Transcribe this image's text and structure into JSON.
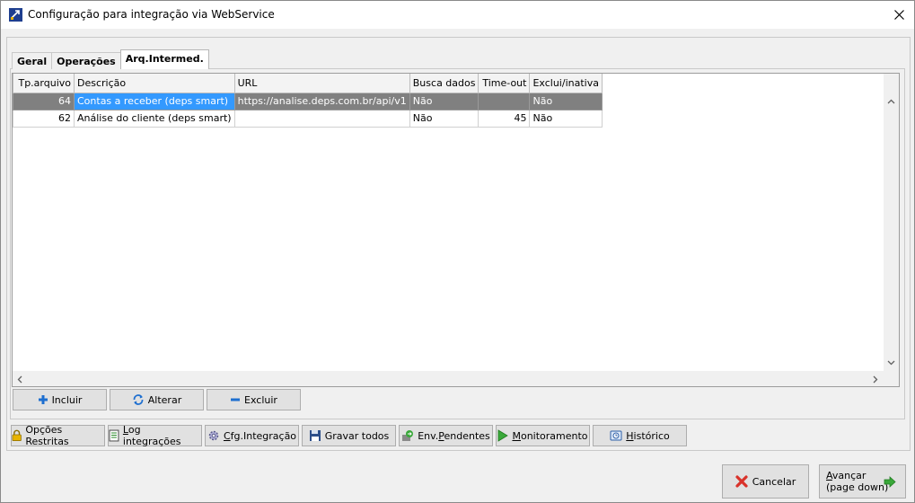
{
  "window": {
    "title": "Configuração para integração via WebService"
  },
  "tabs": [
    "Geral",
    "Operações",
    "Arq.Intermed."
  ],
  "table": {
    "columns": [
      "Tp.arquivo",
      "Descrição",
      "URL",
      "Busca dados",
      "Time-out",
      "Exclui/inativa"
    ],
    "rows": [
      [
        "64",
        "Contas a receber (deps smart)",
        "https://analise.deps.com.br/api/v1",
        "Não",
        "",
        "Não"
      ],
      [
        "62",
        "Análise do cliente (deps smart)",
        "",
        "Não",
        "45",
        "Não"
      ]
    ]
  },
  "grid_buttons": {
    "incluir": "Incluir",
    "alterar": "Alterar",
    "excluir": "Excluir"
  },
  "toolbar": {
    "opcoes_restritas": "Opções Restritas",
    "log_integracoes_a": "L",
    "log_integracoes_b": "og integrações",
    "cfg_integracao_a": "C",
    "cfg_integracao_b": "fg.Integração",
    "gravar_todos": "Gravar todos",
    "env_pendentes_a": "Env.",
    "env_pendentes_b": "P",
    "env_pendentes_c": "endentes",
    "monitoramento_a": "M",
    "monitoramento_b": "onitoramento",
    "historico_a": "H",
    "historico_b": "istórico"
  },
  "footer": {
    "cancelar": "Cancelar",
    "avancar_line1_a": "A",
    "avancar_line1_b": "vançar",
    "avancar_line2": "(page down)"
  },
  "colors": {
    "selection_gray": "#808080",
    "focus_blue": "#3399ff",
    "plus_blue": "#1e6fd0",
    "minus_blue": "#1e6fd0",
    "cancel_red": "#d9322a",
    "next_green": "#3aa83a"
  }
}
